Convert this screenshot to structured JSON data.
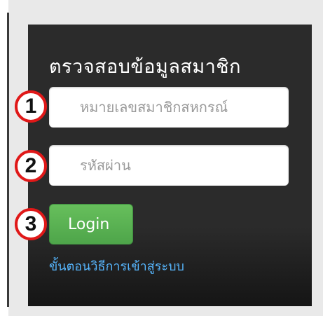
{
  "login_panel": {
    "title": "ตรวจสอบข้อมูลสมาชิก",
    "member_id_placeholder": "หมายเลขสมาชิกสหกรณ์",
    "password_placeholder": "รหัสผ่าน",
    "login_label": "Login",
    "help_link_label": "ขั้นตอนวิธีการเข้าสู่ระบบ"
  },
  "markers": {
    "step1": "1",
    "step2": "2",
    "step3": "3"
  },
  "colors": {
    "panel_bg": "#2b2b2b",
    "login_button": "#5cb85c",
    "link": "#57b7ff",
    "marker_ring": "#e01818"
  }
}
